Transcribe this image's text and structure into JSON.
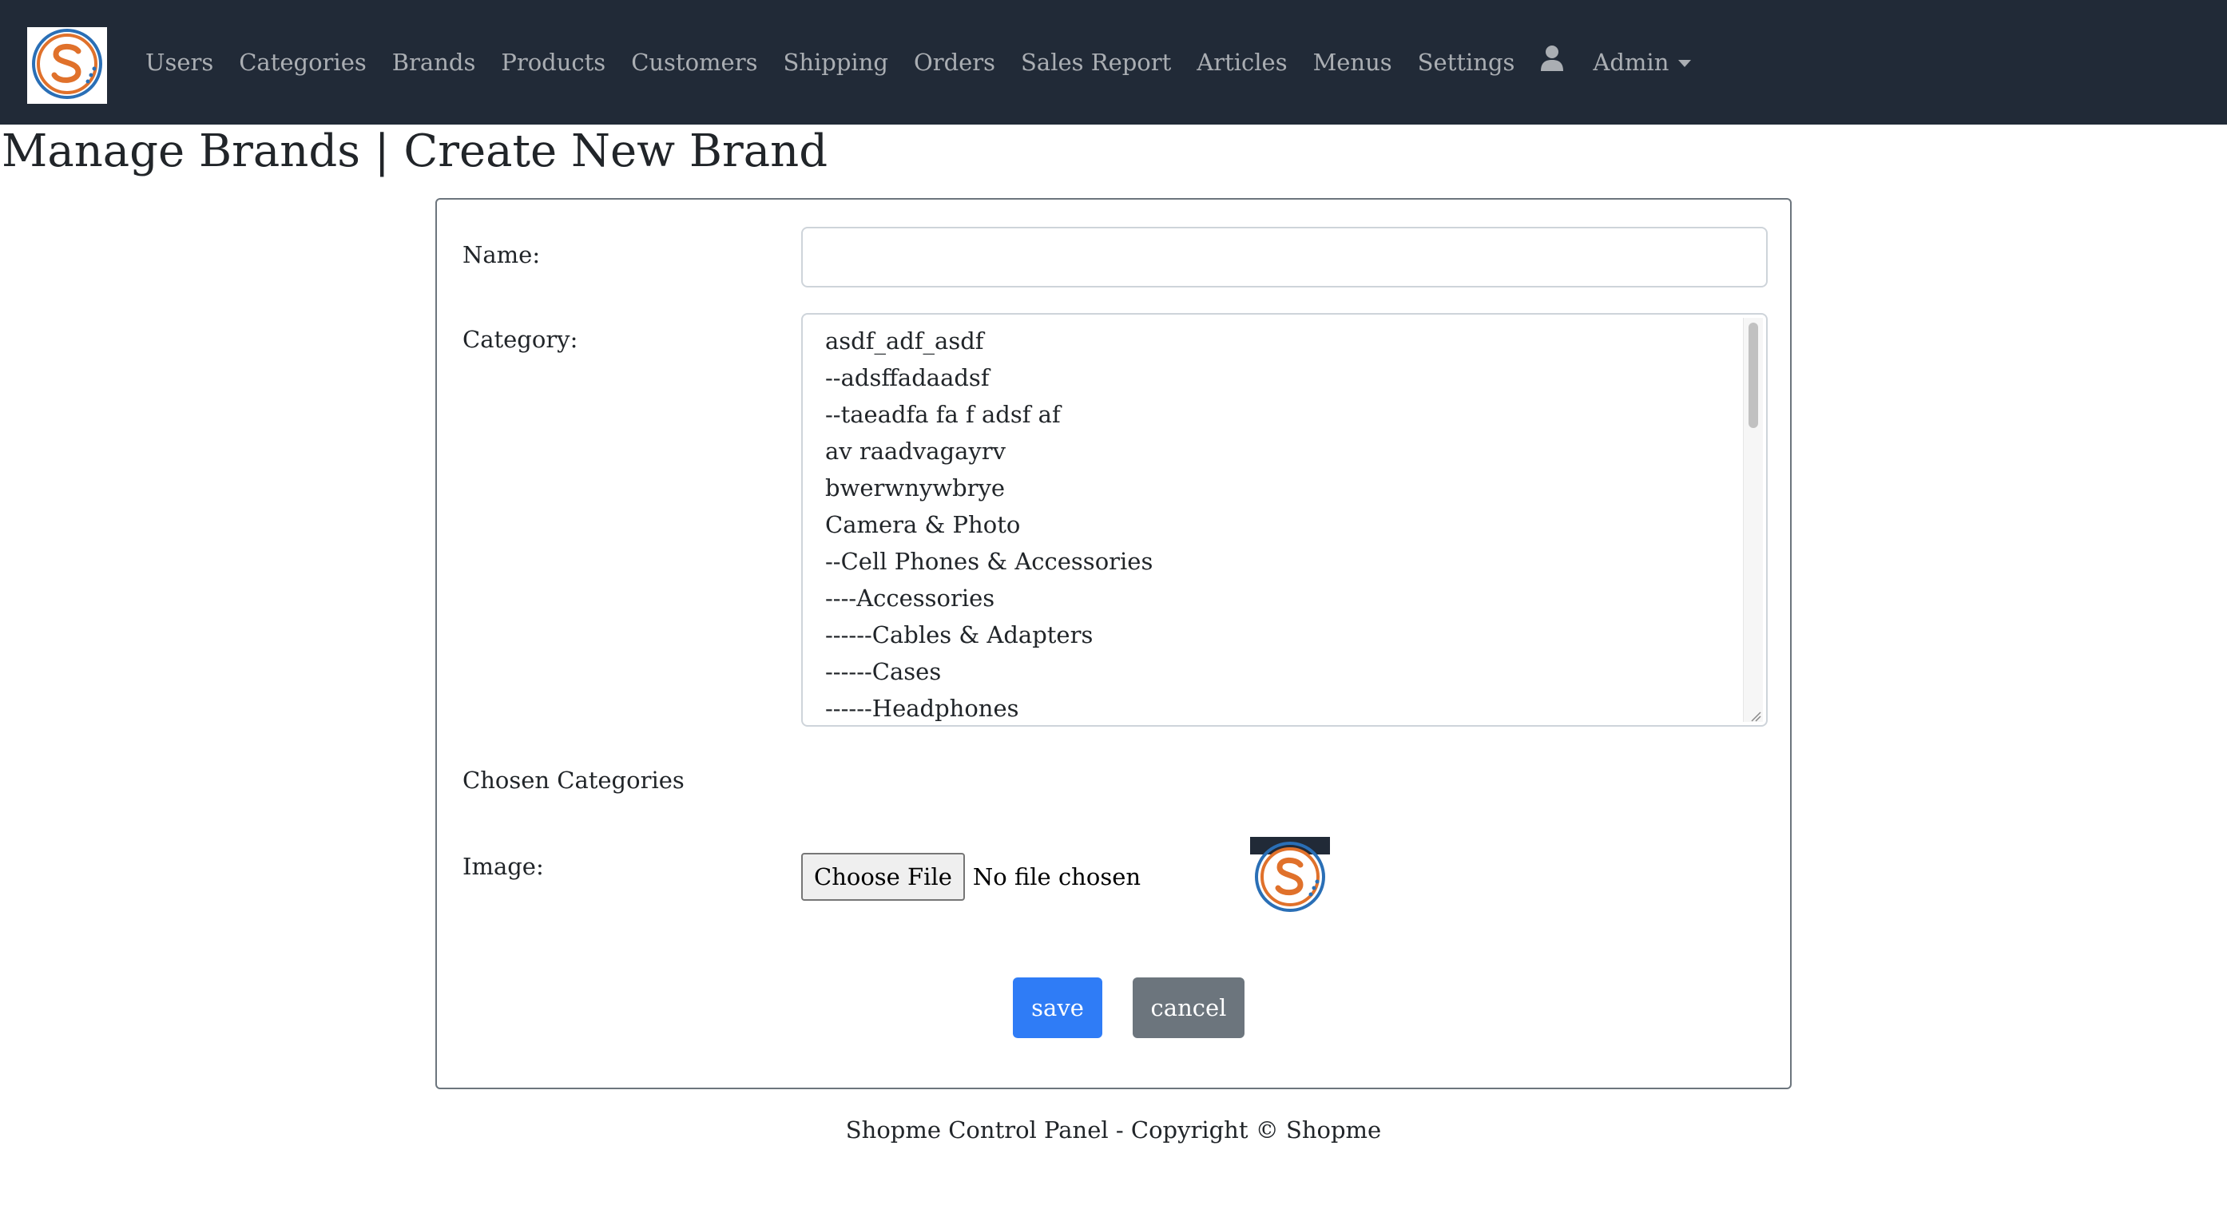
{
  "navbar": {
    "logo_name": "shopme-logo",
    "items": [
      {
        "label": "Users"
      },
      {
        "label": "Categories"
      },
      {
        "label": "Brands"
      },
      {
        "label": "Products"
      },
      {
        "label": "Customers"
      },
      {
        "label": "Shipping"
      },
      {
        "label": "Orders"
      },
      {
        "label": "Sales Report"
      },
      {
        "label": "Articles"
      },
      {
        "label": "Menus"
      },
      {
        "label": "Settings"
      }
    ],
    "user_icon": "user-icon",
    "admin_label": "Admin"
  },
  "page": {
    "title": "Manage Brands | Create New Brand"
  },
  "form": {
    "name_label": "Name:",
    "name_value": "",
    "category_label": "Category:",
    "categories": [
      "asdf_adf_asdf",
      "--adsffadaadsf",
      "--taeadfa fa f adsf af",
      "av raadvagayrv",
      "bwerwnywbrye",
      "Camera & Photo",
      "--Cell Phones & Accessories",
      "----Accessories",
      "------Cables & Adapters",
      "------Cases",
      "------Headphones"
    ],
    "chosen_categories_label": "Chosen Categories",
    "image_label": "Image:",
    "choose_file_label": "Choose File",
    "no_file_text": "No file chosen",
    "save_label": "save",
    "cancel_label": "cancel"
  },
  "footer": {
    "text": "Shopme Control Panel - Copyright © Shopme"
  },
  "colors": {
    "navbar_bg": "#212a37",
    "save_button": "#2f7cf6",
    "cancel_button": "#6c757d",
    "logo_orange": "#e0712b",
    "logo_blue": "#2a6fb6"
  }
}
